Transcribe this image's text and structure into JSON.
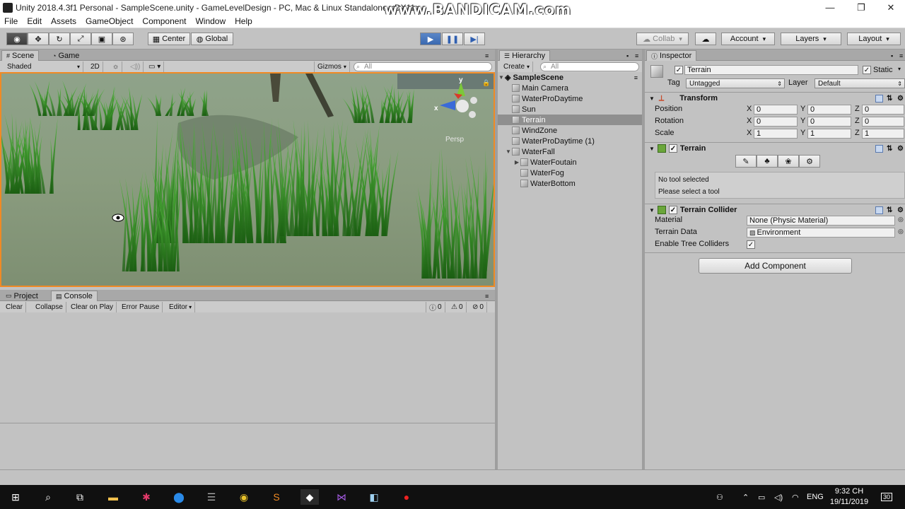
{
  "window": {
    "title": "Unity 2018.4.3f1 Personal - SampleScene.unity - GameLevelDesign - PC, Mac & Linux Standalone <DX11>",
    "watermark": "www.BANDICAM.com",
    "controls": [
      "—",
      "❐",
      "✕"
    ]
  },
  "menu": [
    "File",
    "Edit",
    "Assets",
    "GameObject",
    "Component",
    "Window",
    "Help"
  ],
  "toolbar": {
    "pivot": "Center",
    "space": "Global",
    "collab": "Collab",
    "account": "Account",
    "layers": "Layers",
    "layout": "Layout"
  },
  "scene": {
    "tabs": [
      "Scene",
      "Game"
    ],
    "shading": "Shaded",
    "mode_2d": "2D",
    "gizmos": "Gizmos",
    "search_placeholder": "All",
    "projection": "Persp",
    "gizmo_axes": {
      "y": "y",
      "x": "x"
    }
  },
  "bottom": {
    "tabs": [
      "Project",
      "Console"
    ],
    "buttons": [
      "Clear",
      "Collapse",
      "Clear on Play",
      "Error Pause",
      "Editor"
    ],
    "counts": {
      "info": "0",
      "warn": "0",
      "error": "0"
    }
  },
  "hierarchy": {
    "tab": "Hierarchy",
    "create": "Create",
    "search_placeholder": "All",
    "scene_name": "SampleScene",
    "items": [
      {
        "label": "Main Camera",
        "depth": 1
      },
      {
        "label": "WaterProDaytime",
        "depth": 1
      },
      {
        "label": "Sun",
        "depth": 1
      },
      {
        "label": "Terrain",
        "depth": 1,
        "selected": true
      },
      {
        "label": "WindZone",
        "depth": 1
      },
      {
        "label": "WaterProDaytime (1)",
        "depth": 1
      },
      {
        "label": "WaterFall",
        "depth": 1,
        "expanded": true
      },
      {
        "label": "WaterFoutain",
        "depth": 2,
        "collapsed": true
      },
      {
        "label": "WaterFog",
        "depth": 2
      },
      {
        "label": "WaterBottom",
        "depth": 2
      }
    ]
  },
  "inspector": {
    "tab": "Inspector",
    "object_name": "Terrain",
    "static_label": "Static",
    "tag_label": "Tag",
    "tag_value": "Untagged",
    "layer_label": "Layer",
    "layer_value": "Default",
    "transform": {
      "header": "Transform",
      "rows": [
        {
          "label": "Position",
          "x": "0",
          "y": "0",
          "z": "0"
        },
        {
          "label": "Rotation",
          "x": "0",
          "y": "0",
          "z": "0"
        },
        {
          "label": "Scale",
          "x": "1",
          "y": "1",
          "z": "1"
        }
      ],
      "axis_labels": [
        "X",
        "Y",
        "Z"
      ]
    },
    "terrain": {
      "header": "Terrain",
      "help_line1": "No tool selected",
      "help_line2": "Please select a tool"
    },
    "collider": {
      "header": "Terrain Collider",
      "material_label": "Material",
      "material_value": "None (Physic Material)",
      "data_label": "Terrain Data",
      "data_value": "Environment",
      "trees_label": "Enable Tree Colliders"
    },
    "add_component": "Add Component"
  },
  "taskbar": {
    "lang": "ENG",
    "time": "9:32 CH",
    "date": "19/11/2019",
    "notifications": "30"
  },
  "colors": {
    "selection_outline": "#f08a24",
    "play_blue": "#3a69b0",
    "grass": "#2e8a1e"
  }
}
